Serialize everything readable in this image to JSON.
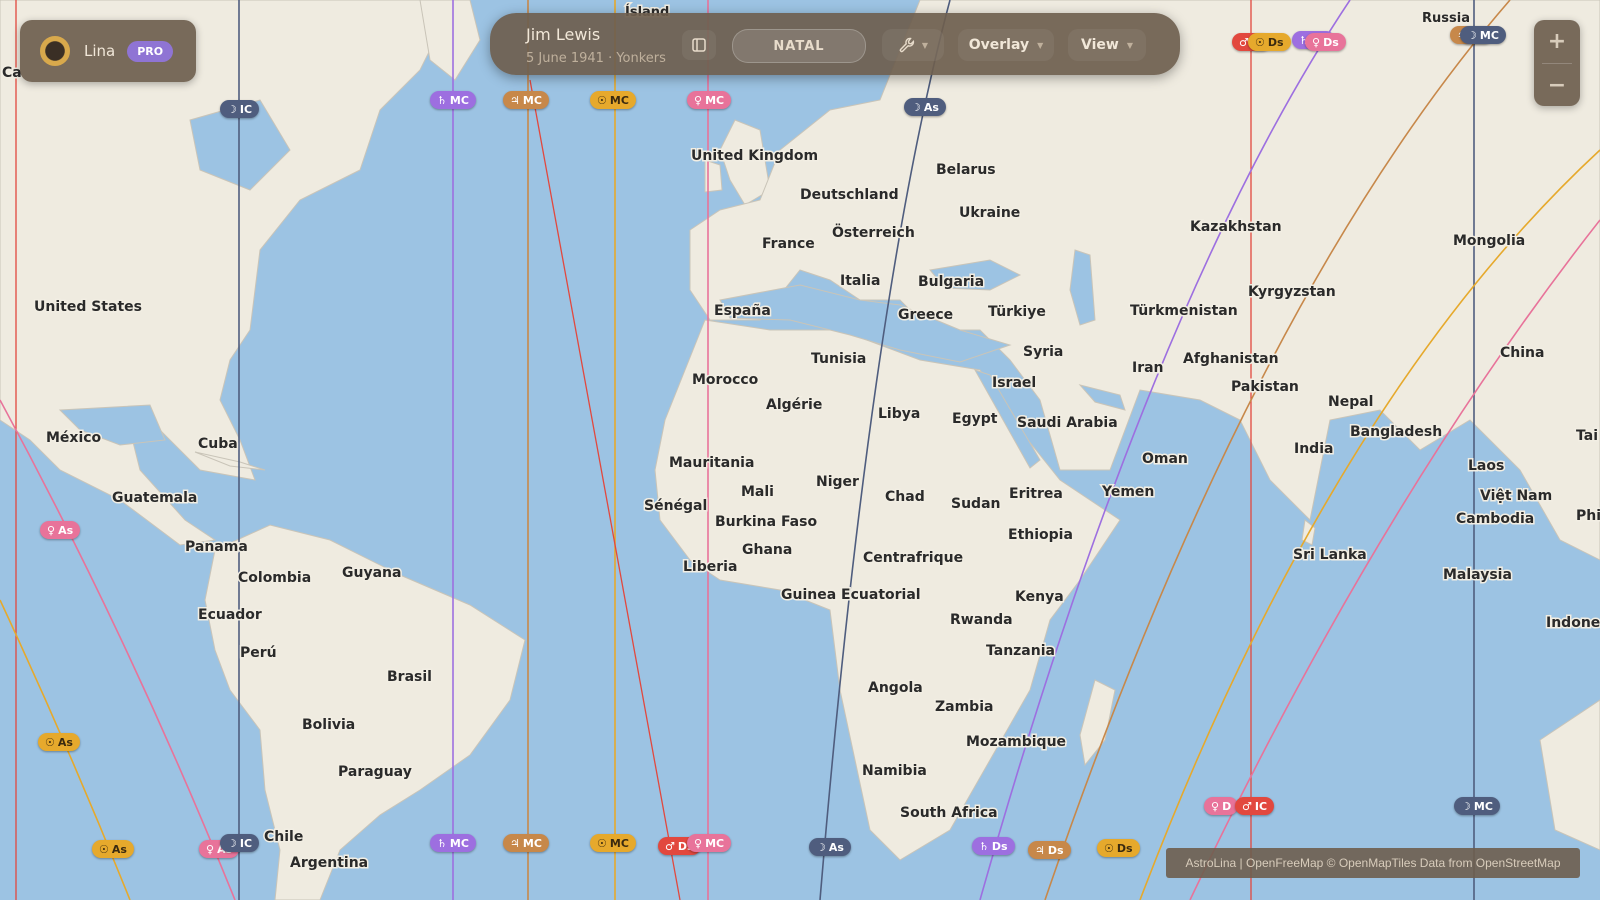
{
  "brand": {
    "name": "Lina",
    "badge": "PRO"
  },
  "chart_header": {
    "person_name": "Jim Lewis",
    "birth_info": "5 June 1941 · Yonkers",
    "mode_label": "NATAL",
    "overlay_label": "Overlay",
    "view_label": "View"
  },
  "zoom": {
    "in": "+",
    "out": "−"
  },
  "attribution": "AstroLina | OpenFreeMap © OpenMapTiles Data from OpenStreetMap",
  "icons": [
    "sun-logo-icon",
    "panel-toggle-icon",
    "wrench-icon",
    "zoom-in-icon",
    "zoom-out-icon"
  ],
  "colors": {
    "ocean": "#9cc3e3",
    "land": "#efebe0",
    "panel": "#6e5e4e",
    "sun": "#e6a92c",
    "moon": "#4f5d7e",
    "venus": "#e8739a",
    "mars": "#e2483e",
    "jupiter": "#c7884a",
    "saturn": "#9d6fe0"
  },
  "glyphs": {
    "sun": "☉",
    "moon": "☽",
    "venus": "♀",
    "mars": "♂",
    "jupiter": "♃",
    "saturn": "♄"
  },
  "country_labels": [
    "Ísland",
    "Russia",
    "United Kingdom",
    "Belarus",
    "Deutschland",
    "Ukraine",
    "Kazakhstan",
    "Mongolia",
    "France",
    "Österreich",
    "Italia",
    "Bulgaria",
    "Kyrgyzstan",
    "United States",
    "España",
    "Greece",
    "Türkiye",
    "Türkmenistan",
    "Tunisia",
    "Syria",
    "Afghanistan",
    "China",
    "Morocco",
    "Israel",
    "Iran",
    "Pakistan",
    "Algérie",
    "Libya",
    "Egypt",
    "Saudi Arabia",
    "Nepal",
    "México",
    "Cuba",
    "Oman",
    "India",
    "Bangladesh",
    "Laos",
    "Mauritania",
    "Mali",
    "Niger",
    "Chad",
    "Sudan",
    "Eritrea",
    "Yemen",
    "Việt Nam",
    "Guatemala",
    "Sénégal",
    "Burkina Faso",
    "Ethiopia",
    "Cambodia",
    "Panama",
    "Ghana",
    "Liberia",
    "Centrafrique",
    "Sri Lanka",
    "Guyana",
    "Colombia",
    "Malaysia",
    "Guinea Ecuatorial",
    "Kenya",
    "Ecuador",
    "Rwanda",
    "Perú",
    "Tanzania",
    "Brasil",
    "Angola",
    "Zambia",
    "Bolivia",
    "Mozambique",
    "Paraguay",
    "Namibia",
    "South Africa",
    "Chile",
    "Argentina",
    "Ca",
    "Tai",
    "Phi",
    "Indone"
  ],
  "line_tags": [
    {
      "planet": "moon",
      "text": "IC"
    },
    {
      "planet": "saturn",
      "text": "MC"
    },
    {
      "planet": "jupiter",
      "text": "MC"
    },
    {
      "planet": "sun",
      "text": "MC"
    },
    {
      "planet": "venus",
      "text": "MC"
    },
    {
      "planet": "moon",
      "text": "As"
    },
    {
      "planet": "mars",
      "text": "IC"
    },
    {
      "planet": "saturn",
      "text": "Ds"
    },
    {
      "planet": "jupiter",
      "text": "Ds"
    },
    {
      "planet": "sun",
      "text": "Ds"
    },
    {
      "planet": "venus",
      "text": "Ds"
    },
    {
      "planet": "venus",
      "text": "As"
    },
    {
      "planet": "sun",
      "text": "As"
    },
    {
      "planet": "sun",
      "text": "As"
    },
    {
      "planet": "venus",
      "text": "As"
    },
    {
      "planet": "moon",
      "text": "IC"
    },
    {
      "planet": "saturn",
      "text": "MC"
    },
    {
      "planet": "jupiter",
      "text": "MC"
    },
    {
      "planet": "sun",
      "text": "MC"
    },
    {
      "planet": "mars",
      "text": "Ds"
    },
    {
      "planet": "venus",
      "text": "MC"
    },
    {
      "planet": "moon",
      "text": "As"
    },
    {
      "planet": "saturn",
      "text": "Ds"
    },
    {
      "planet": "jupiter",
      "text": "Ds"
    },
    {
      "planet": "sun",
      "text": "Ds"
    },
    {
      "planet": "venus",
      "text": "D"
    },
    {
      "planet": "mars",
      "text": "IC"
    },
    {
      "planet": "moon",
      "text": "MC"
    },
    {
      "planet": "moon",
      "text": "MC"
    }
  ]
}
